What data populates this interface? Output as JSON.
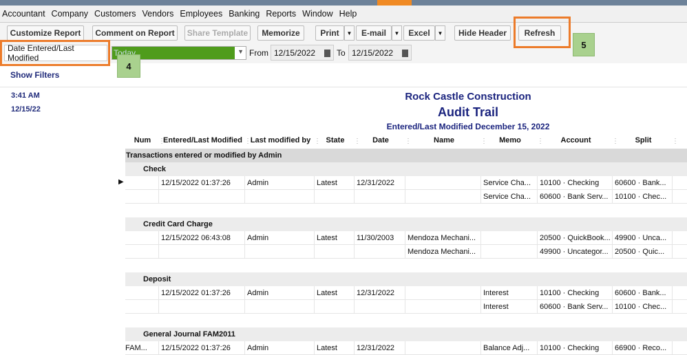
{
  "menu": [
    "Accountant",
    "Company",
    "Customers",
    "Vendors",
    "Employees",
    "Banking",
    "Reports",
    "Window",
    "Help"
  ],
  "toolbar": {
    "customize": "Customize Report",
    "comment": "Comment on Report",
    "share": "Share Template",
    "memorize": "Memorize",
    "print": "Print",
    "email": "E-mail",
    "excel": "Excel",
    "hide_header": "Hide Header",
    "refresh": "Refresh"
  },
  "filter": {
    "date_label": "Date Entered/Last Modified",
    "period": "Today",
    "from_label": "From",
    "from": "12/15/2022",
    "to_label": "To",
    "to": "12/15/2022"
  },
  "callouts": {
    "a": "4",
    "b": "5"
  },
  "left": {
    "show_filters": "Show Filters",
    "time": "3:41 AM",
    "date": "12/15/22"
  },
  "report": {
    "company": "Rock Castle Construction",
    "title": "Audit Trail",
    "subtitle": "Entered/Last Modified December 15, 2022",
    "columns": [
      "Num",
      "Entered/Last Modified",
      "Last modified by",
      "State",
      "Date",
      "Name",
      "Memo",
      "Account",
      "Split"
    ],
    "group": "Transactions entered or modified by Admin",
    "sections": [
      {
        "title": "Check",
        "rows": [
          [
            "",
            "12/15/2022 01:37:26",
            "Admin",
            "Latest",
            "12/31/2022",
            "",
            "Service Cha...",
            "10100 · Checking",
            "60600 · Bank..."
          ],
          [
            "",
            "",
            "",
            "",
            "",
            "",
            "Service Cha...",
            "60600 · Bank Serv...",
            "10100 · Chec..."
          ]
        ]
      },
      {
        "title": "Credit Card Charge",
        "rows": [
          [
            "",
            "12/15/2022 06:43:08",
            "Admin",
            "Latest",
            "11/30/2003",
            "Mendoza Mechani...",
            "",
            "20500 · QuickBook...",
            "49900 · Unca..."
          ],
          [
            "",
            "",
            "",
            "",
            "",
            "Mendoza Mechani...",
            "",
            "49900 · Uncategor...",
            "20500 · Quic..."
          ]
        ]
      },
      {
        "title": "Deposit",
        "rows": [
          [
            "",
            "12/15/2022 01:37:26",
            "Admin",
            "Latest",
            "12/31/2022",
            "",
            "Interest",
            "10100 · Checking",
            "60600 · Bank..."
          ],
          [
            "",
            "",
            "",
            "",
            "",
            "",
            "Interest",
            "60600 · Bank Serv...",
            "10100 · Chec..."
          ]
        ]
      },
      {
        "title": "General Journal FAM2011",
        "rows": [
          [
            "FAM...",
            "12/15/2022 01:37:26",
            "Admin",
            "Latest",
            "12/31/2022",
            "",
            "Balance Adj...",
            "10100 · Checking",
            "66900 · Reco..."
          ]
        ]
      }
    ]
  }
}
